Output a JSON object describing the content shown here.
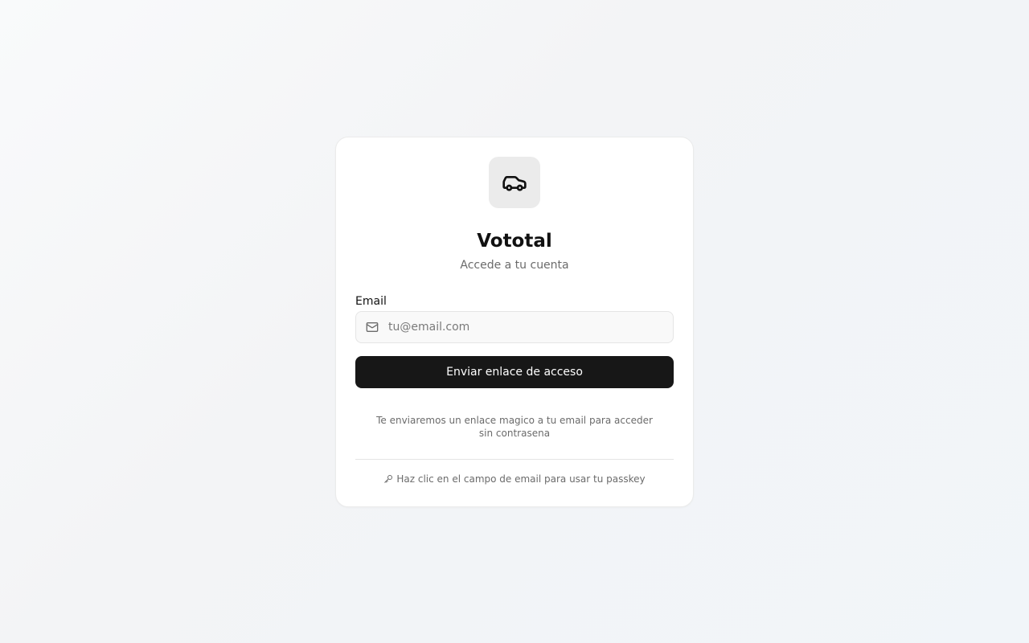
{
  "app": {
    "name": "Vototal",
    "logo_icon": "car-icon"
  },
  "login": {
    "subtitle": "Accede a tu cuenta",
    "email_label": "Email",
    "email_placeholder": "tu@email.com",
    "email_value": "",
    "email_icon": "mail-icon",
    "submit_label": "Enviar enlace de acceso",
    "hint": "Te enviaremos un enlace magico a tu email para acceder sin contrasena",
    "passkey_icon": "key-icon",
    "passkey_hint": "Haz clic en el campo de email para usar tu passkey"
  },
  "colors": {
    "primary_button": "#171717",
    "muted_text": "#6b6b6b",
    "logo_background": "#ebebeb"
  }
}
